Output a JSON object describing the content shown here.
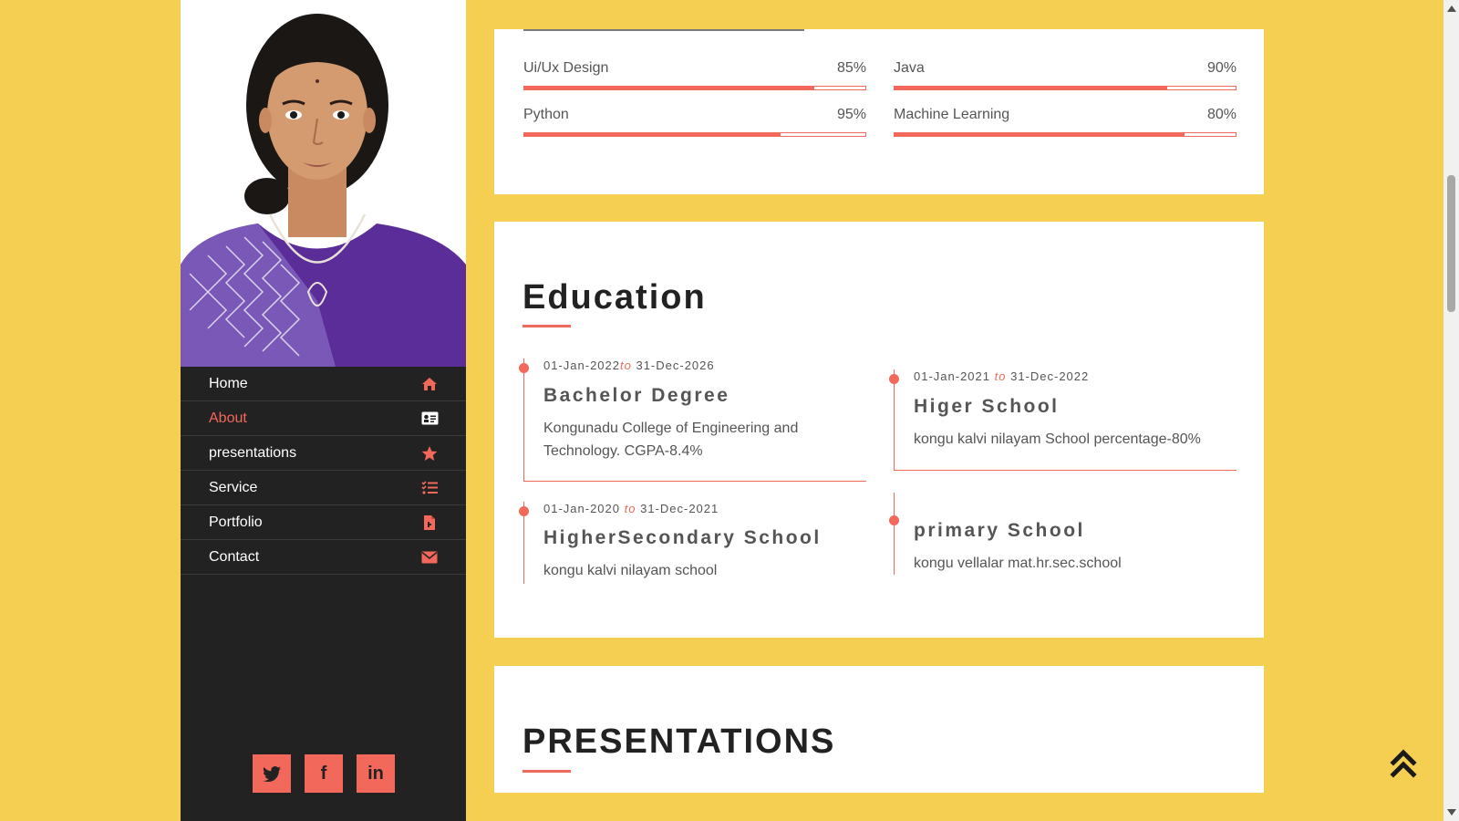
{
  "nav": {
    "items": [
      {
        "label": "Home",
        "icon": "home-icon"
      },
      {
        "label": "About",
        "icon": "id-card-icon",
        "active": true
      },
      {
        "label": "presentations",
        "icon": "star-icon"
      },
      {
        "label": "Service",
        "icon": "list-icon"
      },
      {
        "label": "Portfolio",
        "icon": "file-icon"
      },
      {
        "label": "Contact",
        "icon": "envelope-icon"
      }
    ]
  },
  "social": {
    "twitter": "twitter-icon",
    "facebook": "f",
    "linkedin": "in"
  },
  "skills": [
    {
      "name": "Ui/Ux Design",
      "percent": "85%",
      "fill": 0.85
    },
    {
      "name": "Java",
      "percent": "90%",
      "fill": 0.8
    },
    {
      "name": "Python",
      "percent": "95%",
      "fill": 0.75
    },
    {
      "name": "Machine Learning",
      "percent": "80%",
      "fill": 0.85
    }
  ],
  "education": {
    "title": "Education",
    "items": [
      {
        "from": "01-Jan-2022",
        "to_word": "to",
        "to": "31-Dec-2026",
        "degree": "Bachelor Degree",
        "desc": "Kongunadu College of Engineering and Technology. CGPA-8.4%"
      },
      {
        "from": "01-Jan-2021",
        "to_word": "to",
        "to": "31-Dec-2022",
        "degree": "Higer School",
        "desc": "kongu kalvi nilayam School percentage-80%"
      },
      {
        "from": "01-Jan-2020",
        "to_word": "to",
        "to": "31-Dec-2021",
        "degree": "HigherSecondary School",
        "desc": "kongu kalvi nilayam school"
      },
      {
        "from": "",
        "to_word": "",
        "to": "",
        "degree": "primary School",
        "desc": "kongu vellalar mat.hr.sec.school"
      }
    ]
  },
  "presentations": {
    "title": "PRESENTATIONS"
  },
  "colors": {
    "accent": "#f2685a",
    "background": "#f5cf52",
    "sidebar": "#222222"
  }
}
